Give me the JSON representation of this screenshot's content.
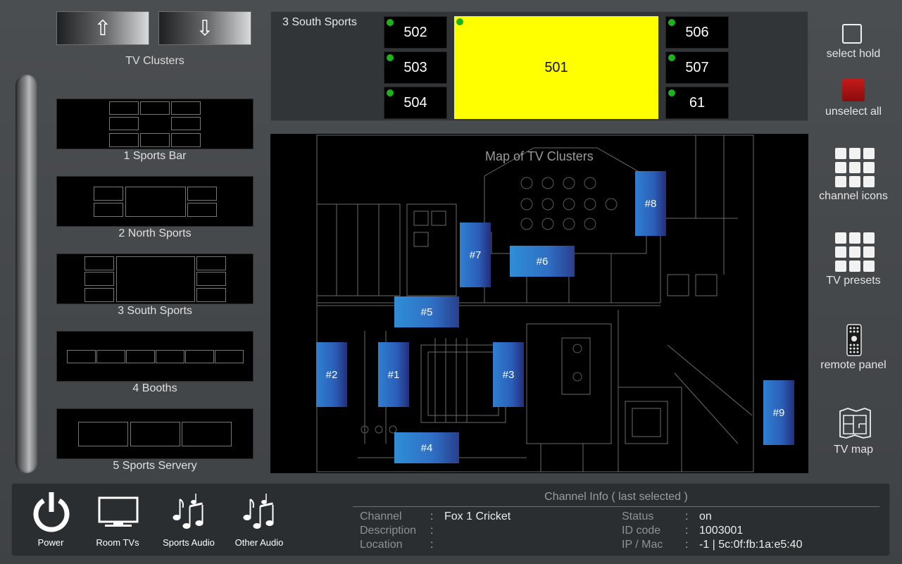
{
  "nav": {
    "up_glyph": "⇧",
    "down_glyph": "⇩",
    "section_title": "TV Clusters"
  },
  "clusters": [
    {
      "label": "1 Sports Bar"
    },
    {
      "label": "2 North Sports"
    },
    {
      "label": "3 South Sports"
    },
    {
      "label": "4 Booths"
    },
    {
      "label": "5 Sports Servery"
    }
  ],
  "cluster_panel": {
    "title": "3 South Sports",
    "tvs_left": [
      "502",
      "503",
      "504"
    ],
    "main_tv": "501",
    "tvs_right": [
      "506",
      "507",
      "61"
    ],
    "active_color": "#ffff00",
    "status_dot_color": "#1db21d"
  },
  "map": {
    "title": "Map of TV Clusters",
    "markers": [
      "#1",
      "#2",
      "#3",
      "#4",
      "#5",
      "#6",
      "#7",
      "#8",
      "#9"
    ]
  },
  "tools": {
    "select_hold": "select hold",
    "unselect_all": "unselect all",
    "channel_icons": "channel icons",
    "tv_presets": "TV presets",
    "remote_panel": "remote panel",
    "tv_map": "TV map"
  },
  "bottom": {
    "power": "Power",
    "room_tvs": "Room TVs",
    "sports_audio": "Sports Audio",
    "other_audio": "Other Audio"
  },
  "channel_info": {
    "title": "Channel Info ( last selected )",
    "channel_key": "Channel",
    "channel_val": "Fox 1 Cricket",
    "description_key": "Description",
    "description_val": "",
    "location_key": "Location",
    "location_val": "",
    "status_key": "Status",
    "status_val": "on",
    "idcode_key": "ID code",
    "idcode_val": "1003001",
    "ipmac_key": "IP / Mac",
    "ipmac_val": "-1 | 5c:0f:fb:1a:e5:40",
    "colon": ":"
  },
  "icons": {
    "up": "arrow-up-icon",
    "down": "arrow-down-icon",
    "select_hold": "checkbox-icon",
    "unselect_all": "stop-icon",
    "channel_icons": "grid-icon",
    "tv_presets": "grid-icon",
    "remote_panel": "remote-icon",
    "tv_map": "floorplan-icon",
    "power": "power-icon",
    "room_tvs": "monitor-icon",
    "sports_audio": "music-notes-icon",
    "other_audio": "music-notes-icon"
  }
}
